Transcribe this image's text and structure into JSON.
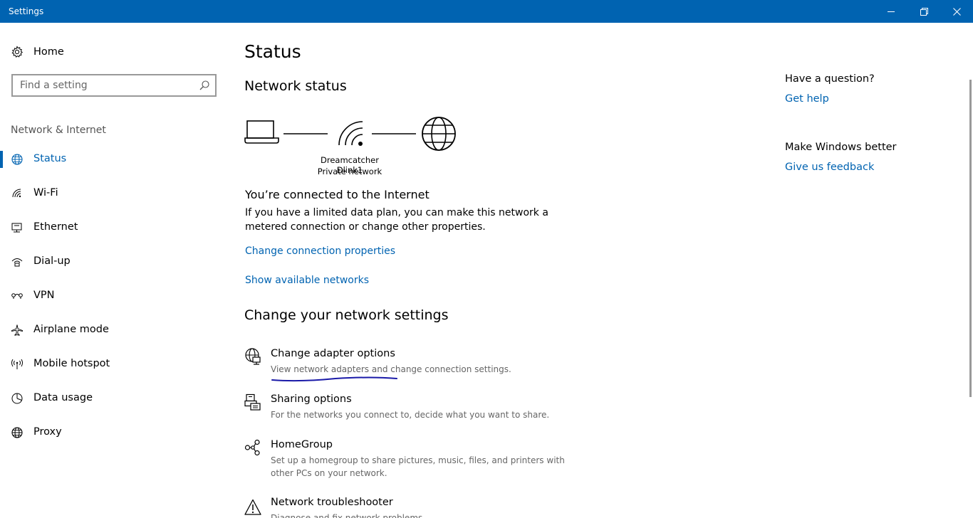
{
  "window": {
    "title": "Settings",
    "minimize_icon": "minimize-icon",
    "maximize_icon": "restore-icon",
    "close_icon": "close-icon"
  },
  "colors": {
    "accent": "#0063b1",
    "titlebar": "#0063b1",
    "annotation": "#1a1aa8"
  },
  "sidebar": {
    "home_label": "Home",
    "search_placeholder": "Find a setting",
    "section_title": "Network & Internet",
    "items": [
      {
        "label": "Status",
        "icon": "globe-icon",
        "active": true
      },
      {
        "label": "Wi-Fi",
        "icon": "wifi-icon"
      },
      {
        "label": "Ethernet",
        "icon": "ethernet-icon"
      },
      {
        "label": "Dial-up",
        "icon": "dialup-icon"
      },
      {
        "label": "VPN",
        "icon": "vpn-icon"
      },
      {
        "label": "Airplane mode",
        "icon": "airplane-icon"
      },
      {
        "label": "Mobile hotspot",
        "icon": "hotspot-icon"
      },
      {
        "label": "Data usage",
        "icon": "data-usage-icon"
      },
      {
        "label": "Proxy",
        "icon": "proxy-icon"
      }
    ]
  },
  "main": {
    "page_title": "Status",
    "network_status_heading": "Network status",
    "network_name": "Dreamcatcher Dlink1",
    "network_type": "Private network",
    "connected_title": "You’re connected to the Internet",
    "connected_desc": "If you have a limited data plan, you can make this network a metered connection or change other properties.",
    "change_connection_link": "Change connection properties",
    "show_networks_link": "Show available networks",
    "change_settings_heading": "Change your network settings",
    "settings": [
      {
        "title": "Change adapter options",
        "desc": "View network adapters and change connection settings.",
        "icon": "adapter-icon"
      },
      {
        "title": "Sharing options",
        "desc": "For the networks you connect to, decide what you want to share.",
        "icon": "sharing-icon"
      },
      {
        "title": "HomeGroup",
        "desc": "Set up a homegroup to share pictures, music, files, and printers with other PCs on your network.",
        "icon": "homegroup-icon"
      },
      {
        "title": "Network troubleshooter",
        "desc": "Diagnose and fix network problems.",
        "icon": "warning-icon"
      }
    ]
  },
  "right": {
    "question": "Have a question?",
    "get_help": "Get help",
    "make_better": "Make Windows better",
    "feedback": "Give us feedback"
  }
}
